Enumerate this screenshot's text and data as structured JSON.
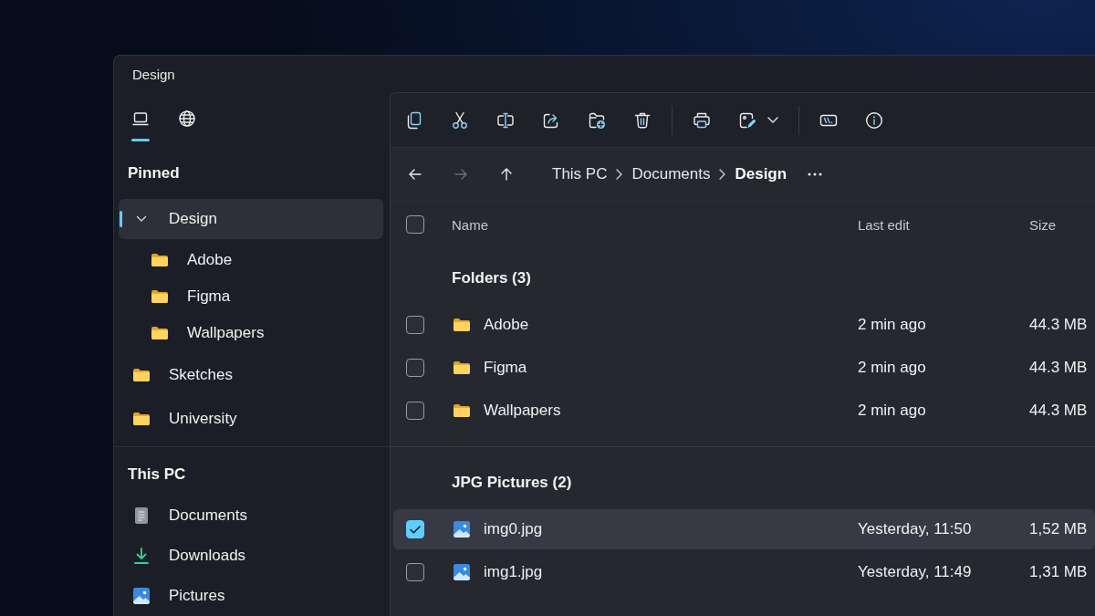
{
  "window": {
    "title": "Design"
  },
  "sidebar": {
    "tabs": [
      {
        "kind": "device",
        "selected": true
      },
      {
        "kind": "network",
        "selected": false
      }
    ],
    "sections": [
      {
        "title": "Pinned",
        "items": [
          {
            "label": "Design",
            "kind": "group",
            "selected": true,
            "expanded": true,
            "children": [
              {
                "label": "Adobe",
                "kind": "folder",
                "selected": false
              },
              {
                "label": "Figma",
                "kind": "folder",
                "selected": false
              },
              {
                "label": "Wallpapers",
                "kind": "folder",
                "selected": false
              }
            ]
          },
          {
            "label": "Sketches",
            "kind": "folder",
            "selected": false
          },
          {
            "label": "University",
            "kind": "folder",
            "selected": false
          }
        ]
      },
      {
        "title": "This PC",
        "items": [
          {
            "label": "Documents",
            "kind": "documents",
            "selected": false
          },
          {
            "label": "Downloads",
            "kind": "downloads",
            "selected": false
          },
          {
            "label": "Pictures",
            "kind": "pictures",
            "selected": false
          }
        ]
      }
    ]
  },
  "toolbar": {
    "groups": [
      [
        {
          "kind": "copy"
        },
        {
          "kind": "cut"
        },
        {
          "kind": "rename"
        },
        {
          "kind": "share"
        },
        {
          "kind": "new-folder"
        },
        {
          "kind": "delete"
        }
      ],
      [
        {
          "kind": "print"
        },
        {
          "kind": "edit",
          "dropdown": true
        }
      ],
      [
        {
          "kind": "terminal"
        },
        {
          "kind": "info"
        }
      ]
    ]
  },
  "navigation": {
    "buttons": [
      {
        "kind": "back",
        "disabled": false
      },
      {
        "kind": "forward",
        "disabled": true
      },
      {
        "kind": "up",
        "disabled": false
      }
    ],
    "breadcrumb": [
      "This PC",
      "Documents",
      "Design"
    ]
  },
  "table": {
    "select_all": {
      "checked": false
    },
    "columns": [
      "Name",
      "Last edit",
      "Size"
    ],
    "groups": [
      {
        "title": "Folders (3)",
        "rows": [
          {
            "kind": "folder",
            "name": "Adobe",
            "last_edit": "2 min ago",
            "size": "44.3 MB",
            "checked": false,
            "selected": false
          },
          {
            "kind": "folder",
            "name": "Figma",
            "last_edit": "2 min ago",
            "size": "44.3 MB",
            "checked": false,
            "selected": false
          },
          {
            "kind": "folder",
            "name": "Wallpapers",
            "last_edit": "2 min ago",
            "size": "44.3 MB",
            "checked": false,
            "selected": false
          }
        ]
      },
      {
        "title": "JPG Pictures (2)",
        "rows": [
          {
            "kind": "image",
            "name": "img0.jpg",
            "last_edit": "Yesterday, 11:50",
            "size": "1,52 MB",
            "checked": true,
            "selected": true
          },
          {
            "kind": "image",
            "name": "img1.jpg",
            "last_edit": "Yesterday, 11:49",
            "size": "1,31 MB",
            "checked": false,
            "selected": false
          }
        ]
      }
    ]
  }
}
